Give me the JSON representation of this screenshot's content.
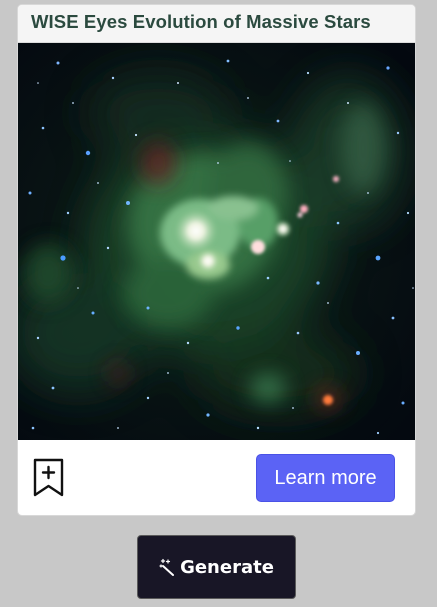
{
  "card": {
    "title": "WISE Eyes Evolution of Massive Stars",
    "image_alt": "Infrared image of a star-forming nebula with green gas clouds and a bright white core",
    "bookmark_icon": "bookmark-plus-icon",
    "learn_more_label": "Learn more"
  },
  "generate": {
    "icon": "magic-wand-icon",
    "label": "Generate"
  },
  "colors": {
    "page_background": "#c8c8c8",
    "card_background": "#ffffff",
    "title_color": "#2b4a3f",
    "primary_button": "#5b63f5",
    "generate_button": "#181626",
    "nebula_green": "#3d8a4a",
    "space_dark": "#050b12"
  }
}
